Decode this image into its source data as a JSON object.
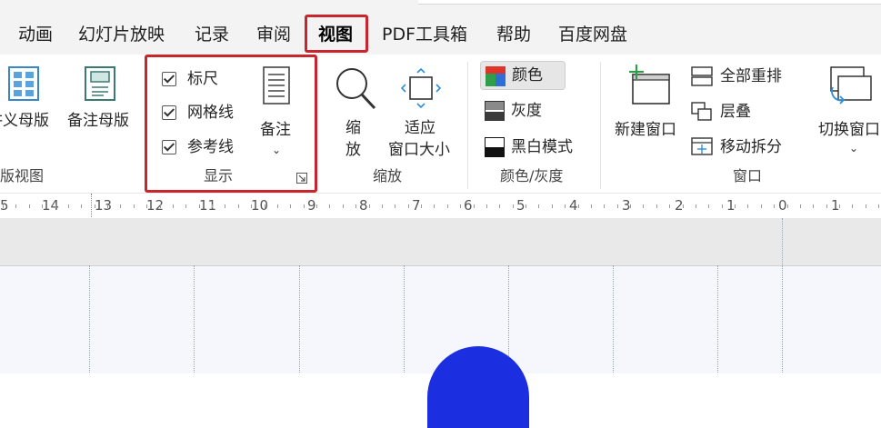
{
  "tabs": [
    {
      "label": "动画"
    },
    {
      "label": "幻灯片放映"
    },
    {
      "label": "记录"
    },
    {
      "label": "审阅"
    },
    {
      "label": "视图",
      "active": true
    },
    {
      "label": "PDF工具箱"
    },
    {
      "label": "帮助"
    },
    {
      "label": "百度网盘"
    }
  ],
  "ribbon": {
    "master": {
      "slide_master_label": "讲义母版",
      "notes_master_label": "备注母版",
      "group_label": "版视图"
    },
    "show": {
      "ruler_label": "标尺",
      "ruler_checked": true,
      "gridlines_label": "网格线",
      "gridlines_checked": true,
      "guides_label": "参考线",
      "guides_checked": true,
      "notes_label": "备注",
      "group_label": "显示"
    },
    "zoom": {
      "zoom_label_1": "缩",
      "zoom_label_2": "放",
      "fit_label_1": "适应",
      "fit_label_2": "窗口大小",
      "group_label": "缩放"
    },
    "color": {
      "color_label": "颜色",
      "grayscale_label": "灰度",
      "bw_label": "黑白模式",
      "group_label": "颜色/灰度"
    },
    "window": {
      "new_window_label": "新建窗口",
      "arrange_all_label": "全部重排",
      "cascade_label": "层叠",
      "move_split_label": "移动拆分",
      "switch_window_label": "切换窗口",
      "group_label": "窗口"
    }
  },
  "ruler": {
    "numbers": [
      "5",
      "14",
      "13",
      "12",
      "11",
      "10",
      "9",
      "8",
      "7",
      "6",
      "5",
      "4",
      "3",
      "2",
      "1",
      "0",
      "1"
    ]
  },
  "colors": {
    "highlight": "#c8252e",
    "shape": "#1c2fe0"
  }
}
